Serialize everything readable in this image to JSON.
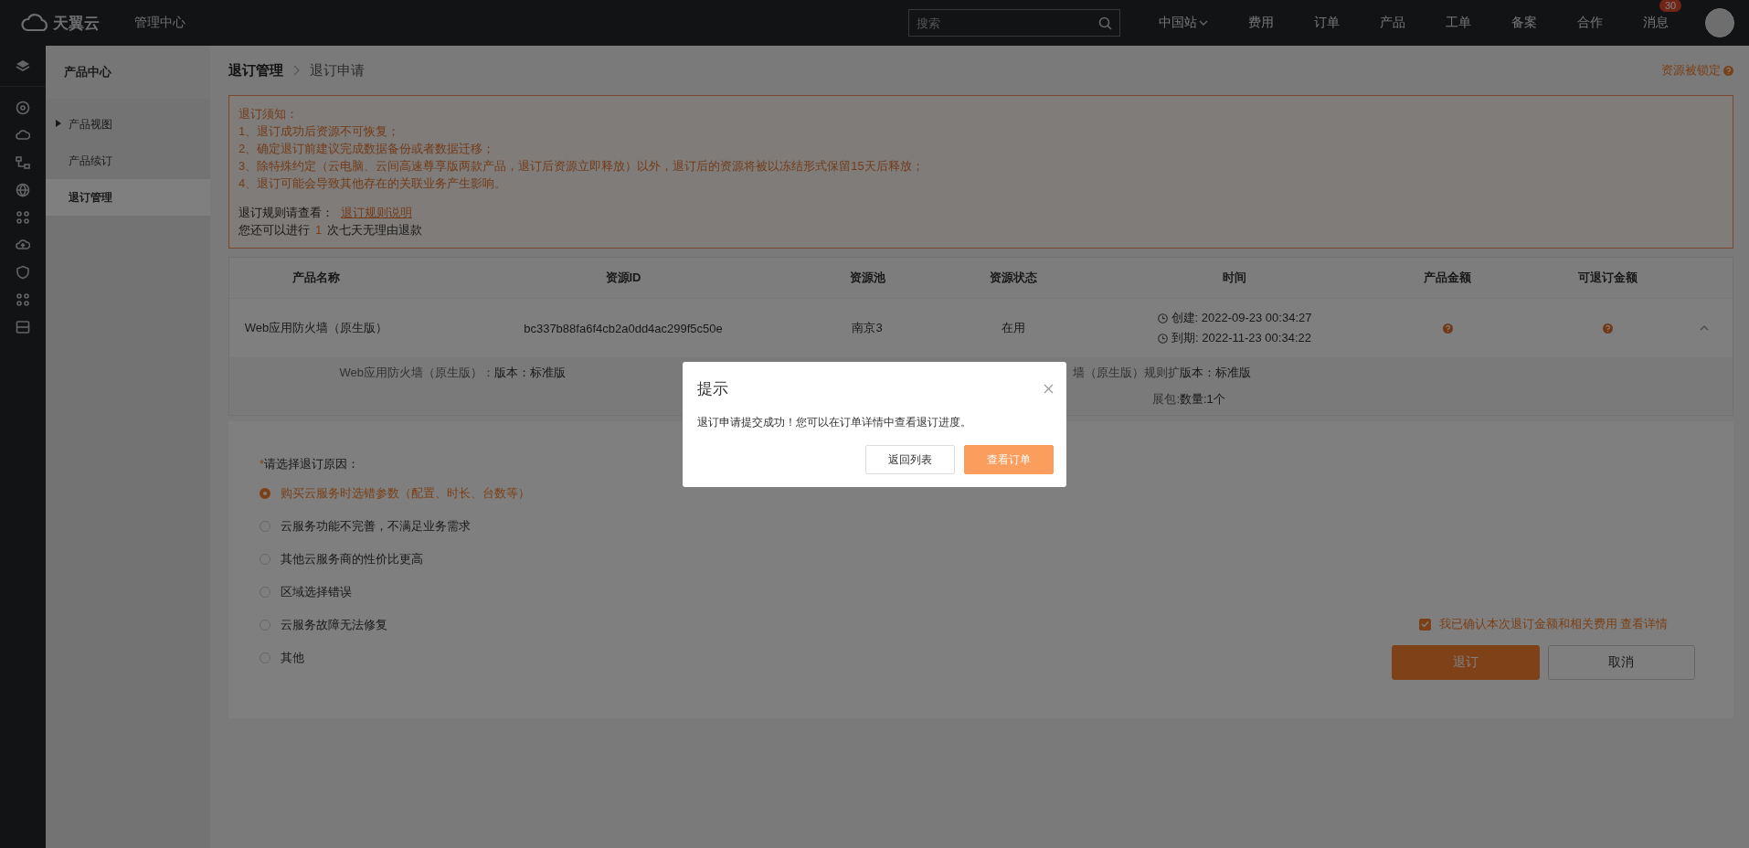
{
  "topbar": {
    "logo_text": "天翼云",
    "console": "管理中心",
    "search": {
      "placeholder": "搜索"
    },
    "nav": [
      {
        "label": "中国站",
        "kind": "dropdown"
      },
      {
        "label": "费用",
        "kind": "link"
      },
      {
        "label": "订单",
        "kind": "link"
      },
      {
        "label": "产品",
        "kind": "link"
      },
      {
        "label": "工单",
        "kind": "link"
      },
      {
        "label": "备案",
        "kind": "link"
      },
      {
        "label": "合作",
        "kind": "link"
      },
      {
        "label": "消息",
        "kind": "badge",
        "badge": "30"
      }
    ]
  },
  "subnav": {
    "title": "产品中心",
    "items": [
      {
        "label": "产品视图",
        "kind": "group",
        "selected": false
      },
      {
        "label": "产品续订",
        "kind": "link",
        "selected": false
      },
      {
        "label": "退订管理",
        "kind": "link",
        "selected": true
      }
    ]
  },
  "breadcrumb": [
    "退订管理",
    "退订申请"
  ],
  "lock_link": "资源被锁定",
  "notice": {
    "lines": [
      "退订须知：",
      "1、退订成功后资源不可恢复；",
      "2、确定退订前建议完成数据备份或者数据迁移；",
      "3、除特殊约定（云电脑、云间高速尊享版两款产品，退订后资源立即释放）以外，退订后的资源将被以冻结形式保留15天后释放；",
      "4、退订可能会导致其他存在的关联业务产生影响。"
    ],
    "rule_label": "退订规则请查看：",
    "rule_link": "退订规则说明",
    "quota_before": "您还可以进行",
    "quota_count": "1",
    "quota_after": "次七天无理由退款"
  },
  "table": {
    "columns": [
      "产品名称",
      "资源ID",
      "资源池",
      "资源状态",
      "时间",
      "产品金额",
      "可退订金额"
    ],
    "rows": [
      {
        "name": "Web应用防火墙（原生版）",
        "resource_id": "bc337b88fa6f4cb2a0dd4ac299f5c50e",
        "pool": "南京3",
        "status": "在用",
        "created": "创建: 2022-09-23 00:34:27",
        "expires": "到期: 2022-11-23 00:34:22",
        "expanded": true,
        "details": [
          {
            "label": "Web应用防火墙（原生版）：",
            "value": "版本：标准版"
          },
          {
            "label": "墙（原生版）规则扩",
            "value": "版本：标准版"
          },
          {
            "label": "展包:",
            "value": "数量:1个"
          }
        ]
      }
    ]
  },
  "form": {
    "required_mark": "*",
    "reason_label": "请选择退订原因：",
    "reasons": [
      {
        "label": "购买云服务时选错参数（配置、时长、台数等）",
        "selected": true
      },
      {
        "label": "云服务功能不完善，不满足业务需求",
        "selected": false
      },
      {
        "label": "其他云服务商的性价比更高",
        "selected": false
      },
      {
        "label": "区域选择错误",
        "selected": false
      },
      {
        "label": "云服务故障无法修复",
        "selected": false
      },
      {
        "label": "其他",
        "selected": false
      }
    ],
    "confirm": {
      "checked": true,
      "text": "我已确认本次退订金额和相关费用",
      "link": "查看详情"
    },
    "buttons": [
      {
        "label": "退订",
        "kind": "primary"
      },
      {
        "label": "取消",
        "kind": "default"
      }
    ]
  },
  "dialog": {
    "title": "提示",
    "message": "退订申请提交成功！您可以在订单详情中查看退订进度。",
    "buttons": [
      {
        "label": "返回列表",
        "kind": "default"
      },
      {
        "label": "查看订单",
        "kind": "primary"
      }
    ]
  }
}
